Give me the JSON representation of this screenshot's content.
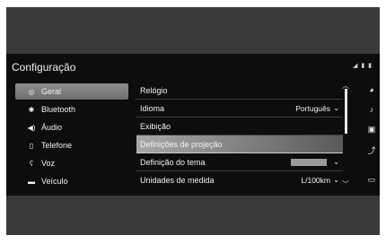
{
  "screen": {
    "title": "Configuração",
    "status_icons": "◢ ▮ ▮"
  },
  "sidebar": {
    "items": [
      {
        "label": "Geral",
        "icon": "gear-icon",
        "glyph": "◎",
        "active": true
      },
      {
        "label": "Bluetooth",
        "icon": "bluetooth-icon",
        "glyph": "✱",
        "active": false
      },
      {
        "label": "Áudio",
        "icon": "speaker-icon",
        "glyph": "◀)",
        "active": false
      },
      {
        "label": "Telefone",
        "icon": "phone-icon",
        "glyph": "▯",
        "active": false
      },
      {
        "label": "Voz",
        "icon": "voice-icon",
        "glyph": "ʕ",
        "active": false
      },
      {
        "label": "Veículo",
        "icon": "car-icon",
        "glyph": "▬",
        "active": false
      }
    ]
  },
  "settings": {
    "rows": [
      {
        "label": "Relógio",
        "value": "",
        "has_chevron": false
      },
      {
        "label": "Idioma",
        "value": "Português",
        "has_chevron": true
      },
      {
        "label": "Exibição",
        "value": "",
        "has_chevron": false
      },
      {
        "label": "Definições de projeção",
        "value": "",
        "has_chevron": false,
        "active": true
      },
      {
        "label": "Definição do tema",
        "value": "",
        "has_chevron": true,
        "swatch": true
      },
      {
        "label": "Unidades de medida",
        "value": "L/100km",
        "has_chevron": true
      }
    ]
  },
  "right_rail": {
    "icons": [
      {
        "name": "navigation-icon",
        "glyph": "◕"
      },
      {
        "name": "music-icon",
        "glyph": "♪"
      },
      {
        "name": "image-icon",
        "glyph": "▣"
      },
      {
        "name": "route-icon",
        "glyph": "⤴"
      },
      {
        "name": "display-icon",
        "glyph": "▭"
      }
    ]
  },
  "colors": {
    "screen_bg": "#0d0d0d",
    "highlight": "#8e8e8e",
    "frame": "#3a3a3a"
  }
}
